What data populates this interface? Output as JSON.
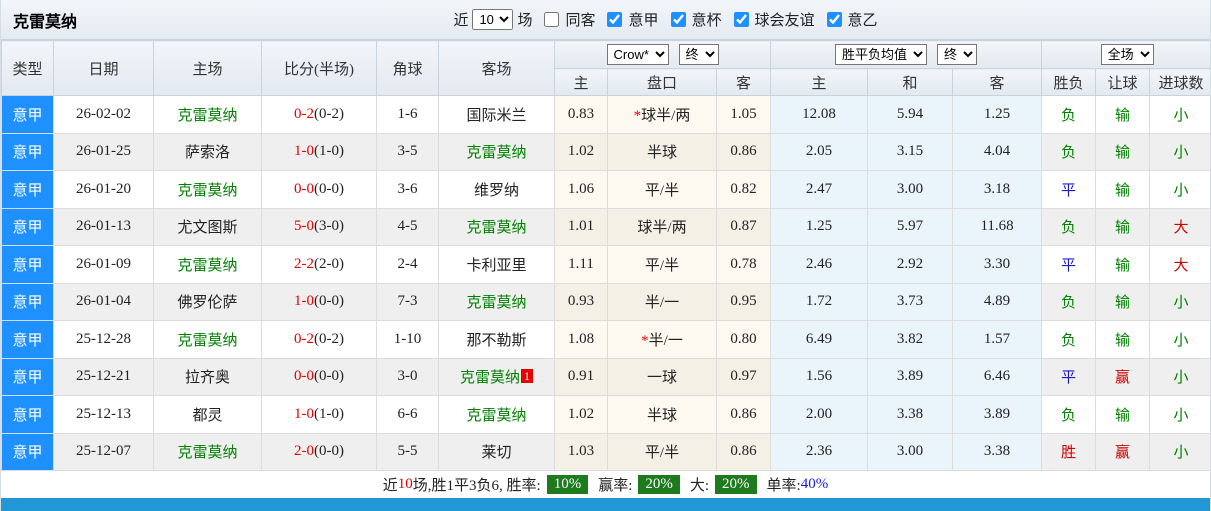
{
  "header": {
    "title": "克雷莫纳",
    "near_label": "近",
    "match_count": "10",
    "games_label": "场",
    "same_away_label": "同客",
    "leagues": [
      {
        "label": "意甲",
        "checked": true
      },
      {
        "label": "意杯",
        "checked": true
      },
      {
        "label": "球会友谊",
        "checked": true
      },
      {
        "label": "意乙",
        "checked": true
      }
    ]
  },
  "table": {
    "columns": [
      "类型",
      "日期",
      "主场",
      "比分(半场)",
      "角球",
      "客场"
    ],
    "sub_columns": [
      "主",
      "盘口",
      "客",
      "主",
      "和",
      "客",
      "胜负",
      "让球",
      "进球数"
    ],
    "selects": {
      "bookmaker": "Crow*",
      "bookmaker_time": "终",
      "avg": "胜平负均值",
      "avg_time": "终",
      "scope": "全场"
    },
    "rows": [
      {
        "type": "意甲",
        "date": "26-02-02",
        "home": "克雷莫纳",
        "home_green": true,
        "score": "0-2",
        "half": "(0-2)",
        "corner": "1-6",
        "away": "国际米兰",
        "away_green": false,
        "away_badge": "",
        "odds_home": "0.83",
        "handicap_star": "*",
        "handicap": "球半/两",
        "odds_away": "1.05",
        "avg_home": "12.08",
        "avg_draw": "5.94",
        "avg_away": "1.25",
        "result": "负",
        "handicap_result": "输",
        "goals": "小"
      },
      {
        "type": "意甲",
        "date": "26-01-25",
        "home": "萨索洛",
        "home_green": false,
        "score": "1-0",
        "half": "(1-0)",
        "corner": "3-5",
        "away": "克雷莫纳",
        "away_green": true,
        "away_badge": "",
        "odds_home": "1.02",
        "handicap_star": "",
        "handicap": "半球",
        "odds_away": "0.86",
        "avg_home": "2.05",
        "avg_draw": "3.15",
        "avg_away": "4.04",
        "result": "负",
        "handicap_result": "输",
        "goals": "小"
      },
      {
        "type": "意甲",
        "date": "26-01-20",
        "home": "克雷莫纳",
        "home_green": true,
        "score": "0-0",
        "half": "(0-0)",
        "corner": "3-6",
        "away": "维罗纳",
        "away_green": false,
        "away_badge": "",
        "odds_home": "1.06",
        "handicap_star": "",
        "handicap": "平/半",
        "odds_away": "0.82",
        "avg_home": "2.47",
        "avg_draw": "3.00",
        "avg_away": "3.18",
        "result": "平",
        "handicap_result": "输",
        "goals": "小"
      },
      {
        "type": "意甲",
        "date": "26-01-13",
        "home": "尤文图斯",
        "home_green": false,
        "score": "5-0",
        "half": "(3-0)",
        "corner": "4-5",
        "away": "克雷莫纳",
        "away_green": true,
        "away_badge": "",
        "odds_home": "1.01",
        "handicap_star": "",
        "handicap": "球半/两",
        "odds_away": "0.87",
        "avg_home": "1.25",
        "avg_draw": "5.97",
        "avg_away": "11.68",
        "result": "负",
        "handicap_result": "输",
        "goals": "大"
      },
      {
        "type": "意甲",
        "date": "26-01-09",
        "home": "克雷莫纳",
        "home_green": true,
        "score": "2-2",
        "half": "(2-0)",
        "corner": "2-4",
        "away": "卡利亚里",
        "away_green": false,
        "away_badge": "",
        "odds_home": "1.11",
        "handicap_star": "",
        "handicap": "平/半",
        "odds_away": "0.78",
        "avg_home": "2.46",
        "avg_draw": "2.92",
        "avg_away": "3.30",
        "result": "平",
        "handicap_result": "输",
        "goals": "大"
      },
      {
        "type": "意甲",
        "date": "26-01-04",
        "home": "佛罗伦萨",
        "home_green": false,
        "score": "1-0",
        "half": "(0-0)",
        "corner": "7-3",
        "away": "克雷莫纳",
        "away_green": true,
        "away_badge": "",
        "odds_home": "0.93",
        "handicap_star": "",
        "handicap": "半/一",
        "odds_away": "0.95",
        "avg_home": "1.72",
        "avg_draw": "3.73",
        "avg_away": "4.89",
        "result": "负",
        "handicap_result": "输",
        "goals": "小"
      },
      {
        "type": "意甲",
        "date": "25-12-28",
        "home": "克雷莫纳",
        "home_green": true,
        "score": "0-2",
        "half": "(0-2)",
        "corner": "1-10",
        "away": "那不勒斯",
        "away_green": false,
        "away_badge": "",
        "odds_home": "1.08",
        "handicap_star": "*",
        "handicap": "半/一",
        "odds_away": "0.80",
        "avg_home": "6.49",
        "avg_draw": "3.82",
        "avg_away": "1.57",
        "result": "负",
        "handicap_result": "输",
        "goals": "小"
      },
      {
        "type": "意甲",
        "date": "25-12-21",
        "home": "拉齐奥",
        "home_green": false,
        "score": "0-0",
        "half": "(0-0)",
        "corner": "3-0",
        "away": "克雷莫纳",
        "away_green": true,
        "away_badge": "1",
        "odds_home": "0.91",
        "handicap_star": "",
        "handicap": "一球",
        "odds_away": "0.97",
        "avg_home": "1.56",
        "avg_draw": "3.89",
        "avg_away": "6.46",
        "result": "平",
        "handicap_result": "赢",
        "goals": "小"
      },
      {
        "type": "意甲",
        "date": "25-12-13",
        "home": "都灵",
        "home_green": false,
        "score": "1-0",
        "half": "(1-0)",
        "corner": "6-6",
        "away": "克雷莫纳",
        "away_green": true,
        "away_badge": "",
        "odds_home": "1.02",
        "handicap_star": "",
        "handicap": "半球",
        "odds_away": "0.86",
        "avg_home": "2.00",
        "avg_draw": "3.38",
        "avg_away": "3.89",
        "result": "负",
        "handicap_result": "输",
        "goals": "小"
      },
      {
        "type": "意甲",
        "date": "25-12-07",
        "home": "克雷莫纳",
        "home_green": true,
        "score": "2-0",
        "half": "(0-0)",
        "corner": "5-5",
        "away": "莱切",
        "away_green": false,
        "away_badge": "",
        "odds_home": "1.03",
        "handicap_star": "",
        "handicap": "平/半",
        "odds_away": "0.86",
        "avg_home": "2.36",
        "avg_draw": "3.00",
        "avg_away": "3.38",
        "result": "胜",
        "handicap_result": "赢",
        "goals": "小"
      }
    ]
  },
  "summary": {
    "near_label": "近",
    "count": "10",
    "record_text": "场,胜1平3负6, 胜率:",
    "win_rate": "10%",
    "handicap_label": "赢率:",
    "handicap_rate": "20%",
    "big_label": "大:",
    "big_rate": "20%",
    "single_label": "单率:",
    "single_rate": "40%"
  },
  "colors": {
    "accent_blue": "#1e90ff",
    "team_green": "#008000",
    "score_red": "#e60000",
    "badge_green_bg": "#1d7a1d",
    "bottom_bar_blue": "#2197d5",
    "result_text": {
      "胜": "#cc0000",
      "平": "#1a1acd",
      "负": "#008000",
      "赢": "#cc0000",
      "输": "#008000",
      "大": "#cc0000",
      "小": "#008000"
    }
  }
}
